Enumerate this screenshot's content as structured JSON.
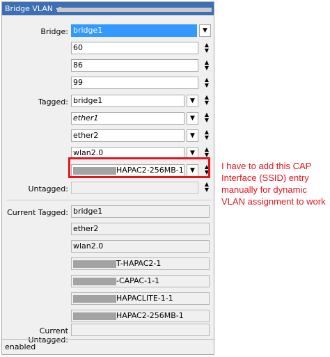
{
  "window": {
    "title": "Bridge VLAN <",
    "status": "enabled"
  },
  "form": {
    "bridge_label": "Bridge:",
    "bridge_value": "bridge1",
    "vlan_ids": [
      "60",
      "86",
      "99"
    ],
    "tagged_label": "Tagged:",
    "tagged": [
      "bridge1",
      "ether1",
      "ether2",
      "wlan2.0",
      "HAPAC2-256MB-1"
    ],
    "untagged_label": "Untagged:",
    "current_tagged_label": "Current Tagged:",
    "current_tagged": [
      "bridge1",
      "ether2",
      "wlan2.0",
      "T-HAPAC2-1",
      "-CAPAC-1-1",
      "HAPACLITE-1-1",
      "HAPAC2-256MB-1"
    ],
    "current_untagged_label": "Current Untagged:"
  },
  "annotation": {
    "note": "I have to add this CAP Interface (SSID) entry manually for dynamic VLAN assignment to work",
    "color": "#e8141c"
  },
  "icons": {
    "dropdown": "dropdown-arrow-icon",
    "updown": "up-down-arrows-icon"
  }
}
